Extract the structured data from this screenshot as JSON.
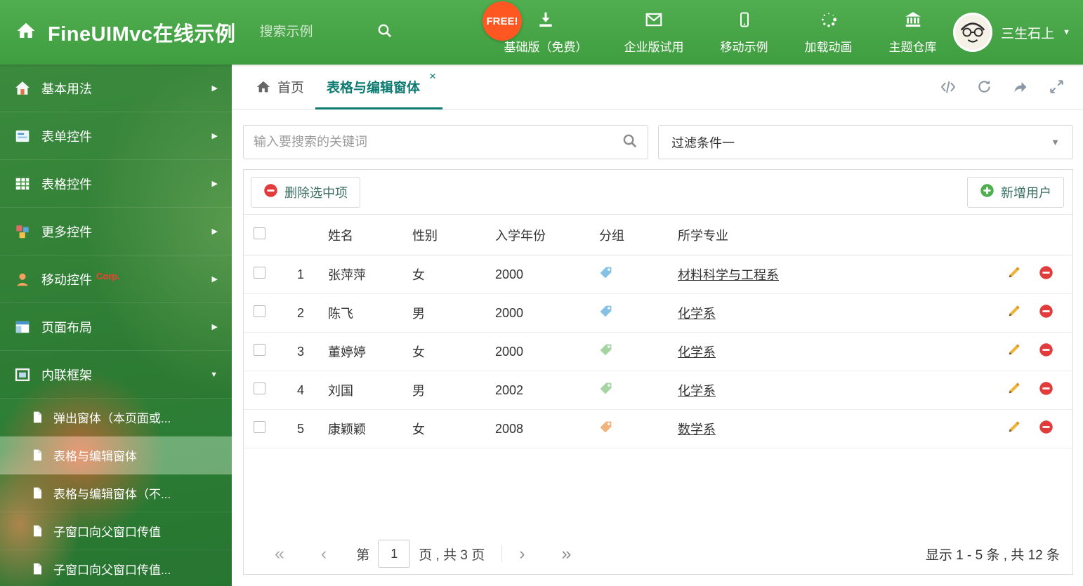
{
  "header": {
    "brand": "FineUIMvc在线示例",
    "search_placeholder": "搜索示例",
    "free_badge": "FREE!",
    "nav": [
      {
        "label": "基础版（免费）"
      },
      {
        "label": "企业版试用"
      },
      {
        "label": "移动示例"
      },
      {
        "label": "加载动画"
      },
      {
        "label": "主题仓库"
      }
    ],
    "user_name": "三生石上"
  },
  "sidebar": {
    "items": [
      {
        "label": "基本用法"
      },
      {
        "label": "表单控件"
      },
      {
        "label": "表格控件"
      },
      {
        "label": "更多控件"
      },
      {
        "label": "移动控件",
        "badge": "Corp."
      },
      {
        "label": "页面布局"
      },
      {
        "label": "内联框架"
      }
    ],
    "subitems": [
      {
        "label": "弹出窗体（本页面或..."
      },
      {
        "label": "表格与编辑窗体"
      },
      {
        "label": "表格与编辑窗体（不..."
      },
      {
        "label": "子窗口向父窗口传值"
      },
      {
        "label": "子窗口向父窗口传值..."
      }
    ]
  },
  "tabs": {
    "home": "首页",
    "active": "表格与编辑窗体"
  },
  "filters": {
    "search_placeholder": "输入要搜索的关键词",
    "selected_filter": "过滤条件一"
  },
  "toolbar": {
    "delete_label": "删除选中项",
    "add_label": "新增用户"
  },
  "table": {
    "columns": {
      "name": "姓名",
      "gender": "性别",
      "year": "入学年份",
      "group": "分组",
      "major": "所学专业"
    },
    "rows": [
      {
        "num": "1",
        "name": "张萍萍",
        "gender": "女",
        "year": "2000",
        "tag_color": "#85c1e5",
        "major": "材料科学与工程系"
      },
      {
        "num": "2",
        "name": "陈飞",
        "gender": "男",
        "year": "2000",
        "tag_color": "#85c1e5",
        "major": "化学系"
      },
      {
        "num": "3",
        "name": "董婷婷",
        "gender": "女",
        "year": "2000",
        "tag_color": "#a4d4a0",
        "major": "化学系"
      },
      {
        "num": "4",
        "name": "刘国",
        "gender": "男",
        "year": "2002",
        "tag_color": "#a4d4a0",
        "major": "化学系"
      },
      {
        "num": "5",
        "name": "康颖颖",
        "gender": "女",
        "year": "2008",
        "tag_color": "#f2b27e",
        "major": "数学系"
      }
    ]
  },
  "pager": {
    "page_prefix": "第",
    "page_value": "1",
    "page_suffix": "页 , 共 3 页",
    "summary": "显示 1 - 5 条 , 共 12 条"
  },
  "icons": {
    "chevron_right": "▶",
    "chevron_down": "▼",
    "caret_down": "▼",
    "close": "×",
    "first": "«",
    "prev": "‹",
    "next": "›",
    "last": "»"
  },
  "colors": {
    "accent_teal": "#0d7b72",
    "header_green": "#46a246",
    "danger_red": "#e23b3b",
    "success_green": "#4fae4f"
  }
}
